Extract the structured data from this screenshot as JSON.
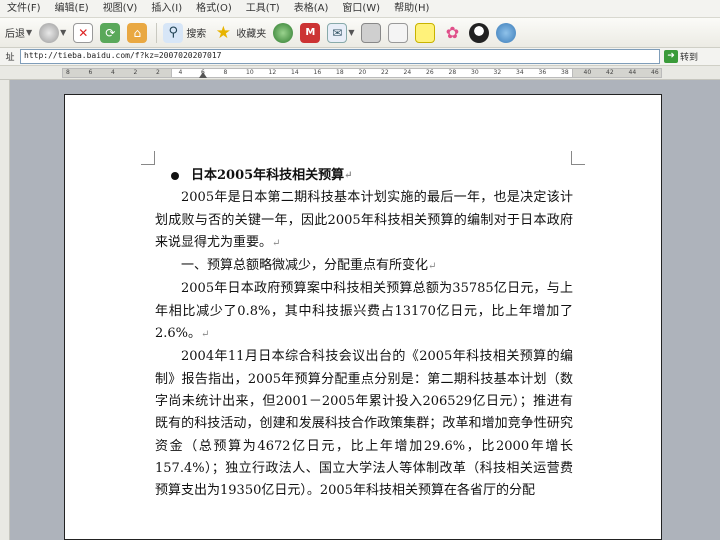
{
  "menu": [
    "文件(F)",
    "编辑(E)",
    "视图(V)",
    "插入(I)",
    "格式(O)",
    "工具(T)",
    "表格(A)",
    "窗口(W)",
    "帮助(H)"
  ],
  "toolbar": {
    "back_label": "后退",
    "search_label": "搜索",
    "favorites_label": "收藏夹"
  },
  "address": {
    "label": "址",
    "url": "http://tieba.baidu.com/f?kz=2007020207017",
    "go_label": "转到"
  },
  "ruler": {
    "ticks": [
      "8",
      "6",
      "4",
      "2",
      "2",
      "4",
      "6",
      "8",
      "10",
      "12",
      "14",
      "16",
      "18",
      "20",
      "22",
      "24",
      "26",
      "28",
      "30",
      "32",
      "34",
      "36",
      "38",
      "40",
      "42",
      "44",
      "46"
    ]
  },
  "document": {
    "title": "日本2005年科技相关预算",
    "paragraphs": [
      "2005年是日本第二期科技基本计划实施的最后一年，也是决定该计划成败与否的关键一年，因此2005年科技相关预算的编制对于日本政府来说显得尤为重要。",
      "2005年日本政府预算案中科技相关预算总额为35785亿日元，与上年相比减少了0.8%，其中科技振兴费占13170亿日元，比上年增加了2.6%。",
      "2004年11月日本综合科技会议出台的《2005年科技相关预算的编制》报告指出，2005年预算分配重点分别是：第二期科技基本计划（数字尚未统计出来，但2001－2005年累计投入206529亿日元）；推进有既有的科技活动，创建和发展科技合作政策集群；改革和增加竞争性研究资金（总预算为4672亿日元，比上年增加29.6%，比2000年增长157.4%）；独立行政法人、国立大学法人等体制改革（科技相关运营费预算支出为19350亿日元）。2005年科技相关预算在各省厅的分配"
    ],
    "section_heading": "一、预算总额略微减少，分配重点有所变化"
  }
}
